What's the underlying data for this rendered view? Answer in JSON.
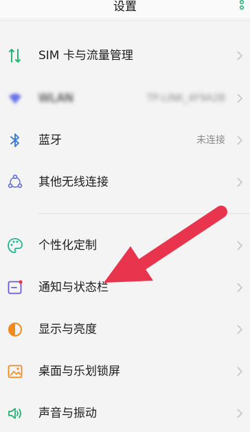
{
  "header": {
    "title": "设置"
  },
  "rows": [
    {
      "label": "SIM 卡与流量管理",
      "status": ""
    },
    {
      "label": "WLAN",
      "status": "TP-LINK_4F9A2B"
    },
    {
      "label": "蓝牙",
      "status": "未连接"
    },
    {
      "label": "其他无线连接",
      "status": ""
    },
    {
      "label": "个性化定制",
      "status": ""
    },
    {
      "label": "通知与状态栏",
      "status": ""
    },
    {
      "label": "显示与亮度",
      "status": ""
    },
    {
      "label": "桌面与乐划锁屏",
      "status": ""
    },
    {
      "label": "声音与振动",
      "status": ""
    }
  ],
  "colors": {
    "accent_green": "#1fb574",
    "arrow_red": "#e8344d",
    "bluetooth_blue": "#3a7bd5"
  },
  "icons": [
    "sim-data-icon",
    "wlan-icon",
    "bluetooth-icon",
    "wireless-connections-icon",
    "palette-icon",
    "notification-icon",
    "display-brightness-icon",
    "wallpaper-icon",
    "sound-icon"
  ]
}
